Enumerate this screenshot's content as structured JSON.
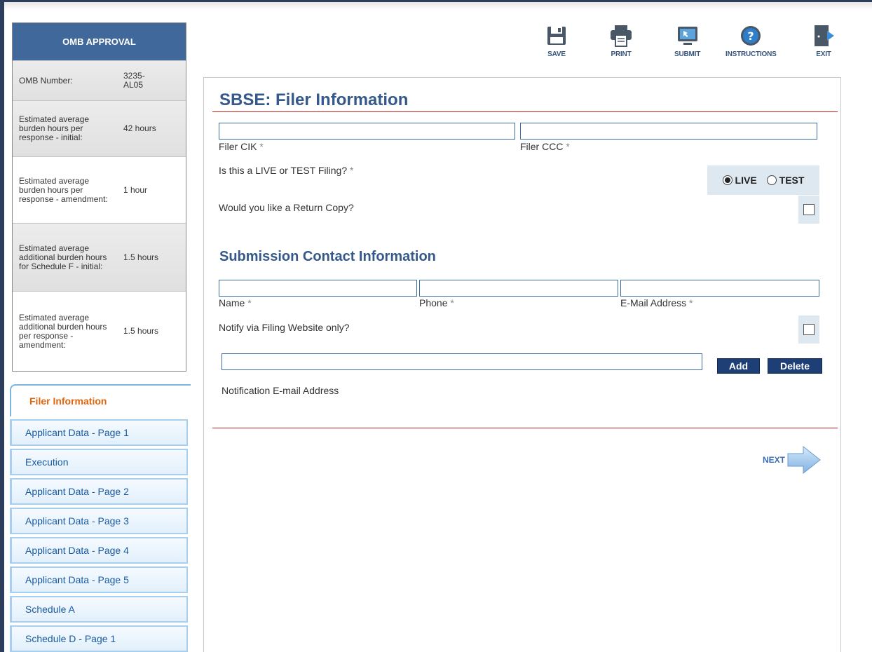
{
  "toolbar": {
    "save": "SAVE",
    "print": "PRINT",
    "submit": "SUBMIT",
    "instructions": "INSTRUCTIONS",
    "exit": "EXIT"
  },
  "omb": {
    "title": "OMB APPROVAL",
    "rows": [
      {
        "label": "OMB Number:",
        "value": "3235-AL05"
      },
      {
        "label": "Estimated average burden hours per response - initial:",
        "value": "42 hours"
      },
      {
        "label": "Estimated average burden hours per response - amendment:",
        "value": "1 hour"
      },
      {
        "label": "Estimated average additional burden hours for Schedule F - initial:",
        "value": "1.5 hours"
      },
      {
        "label": "Estimated average additional burden hours per response - amendment:",
        "value": "1.5 hours"
      }
    ]
  },
  "nav": {
    "active": "Filer Information",
    "items": [
      "Applicant Data - Page 1",
      "Execution",
      "Applicant Data - Page 2",
      "Applicant Data - Page 3",
      "Applicant Data - Page 4",
      "Applicant Data - Page 5",
      "Schedule A",
      "Schedule D - Page 1"
    ]
  },
  "form": {
    "title": "SBSE: Filer Information",
    "filer_cik_label": "Filer CIK",
    "filer_ccc_label": "Filer CCC",
    "required_mark": "*",
    "live_test_question": "Is this a LIVE or TEST Filing?",
    "live_label": "LIVE",
    "test_label": "TEST",
    "selected": "LIVE",
    "return_copy_question": "Would you like a Return Copy?",
    "contact_heading": "Submission Contact Information",
    "name_label": "Name",
    "phone_label": "Phone",
    "email_label": "E-Mail Address",
    "notify_question": "Notify via Filing Website only?",
    "notification_email_label": "Notification E-mail Address",
    "add_label": "Add",
    "delete_label": "Delete",
    "next_label": "NEXT"
  },
  "colors": {
    "brand": "#40689a",
    "title": "#35598a",
    "accent_orange": "#e0650c",
    "rule_red": "#c41a1a",
    "button": "#1e3f76"
  }
}
